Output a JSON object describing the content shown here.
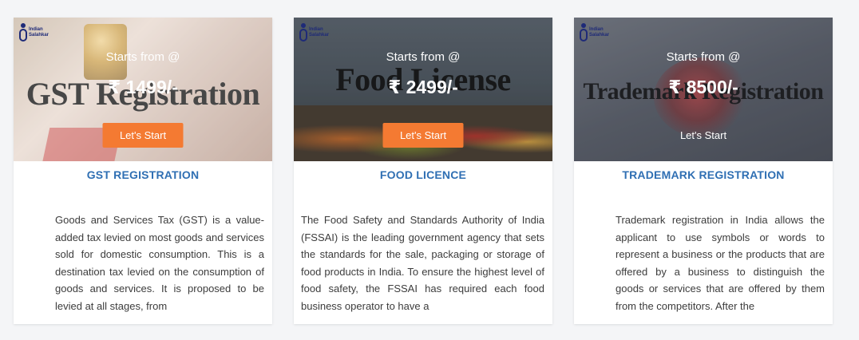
{
  "cards": [
    {
      "banner_word": "GST Registration",
      "logo_text": "Indian\nSalahkar",
      "starts_from": "Starts from @",
      "price": "₹ 1499/-",
      "cta_label": "Let's Start",
      "title": "GST REGISTRATION",
      "description": "Goods and Services Tax (GST) is a value-added tax levied on most goods and services sold for domestic consumption. This is a destination  tax levied on the consumption of goods and services. It is proposed to be levied at all stages, from"
    },
    {
      "banner_word": "Food License",
      "logo_text": "Indian\nSalahkar",
      "starts_from": "Starts from @",
      "price": "₹ 2499/-",
      "cta_label": "Let's Start",
      "title": "FOOD LICENCE",
      "description": "The Food Safety and Standards Authority of India (FSSAI) is the leading government agency that sets the standards for the sale, packaging or storage of food products in India. To ensure the highest level of food safety, the FSSAI has required each food business operator to have a"
    },
    {
      "banner_word": "Trademark Registration",
      "logo_text": "Indian\nSalahkar",
      "starts_from": "Starts from @",
      "price": "₹ 8500/-",
      "cta_label": "Let's Start",
      "title": "TRADEMARK REGISTRATION",
      "description": "Trademark registration in India allows the applicant to use symbols or words to represent a business or the products that are offered by a business to distinguish the goods or services that are offered by them from the competitors.  After the"
    }
  ],
  "colors": {
    "cta_orange": "#f47a32",
    "title_blue": "#2f6fb3",
    "page_bg": "#f4f5f7"
  }
}
